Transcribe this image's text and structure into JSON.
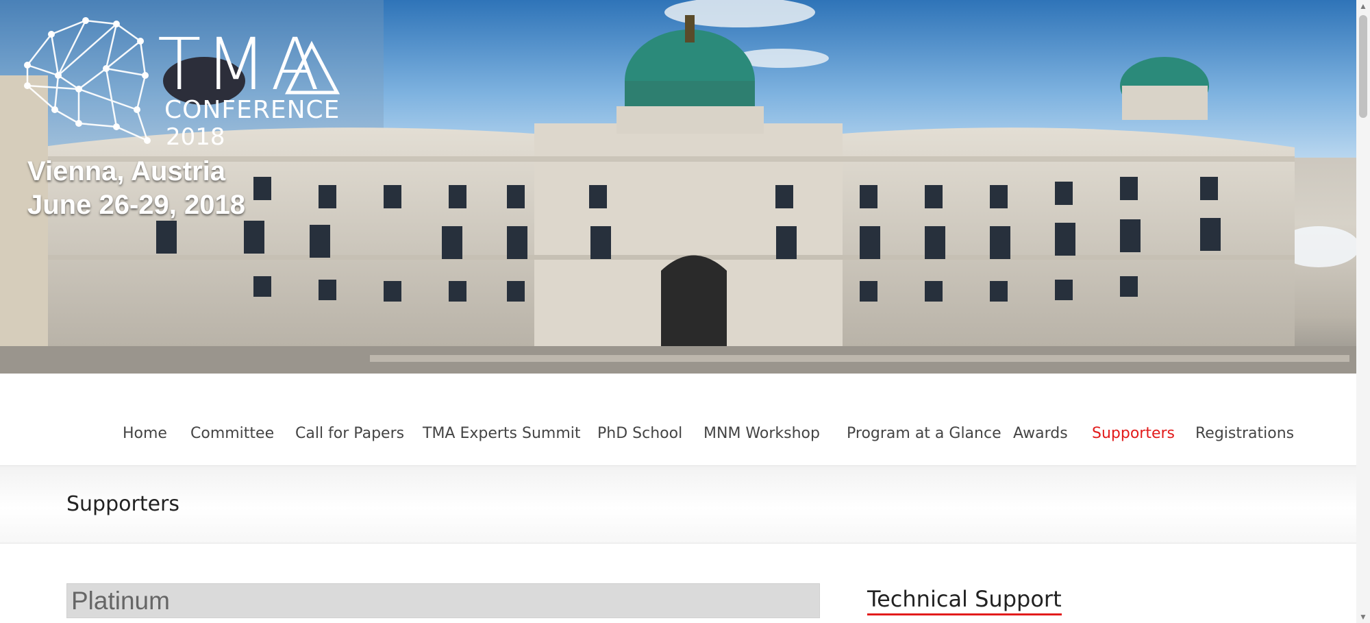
{
  "banner": {
    "logo": {
      "title": "TMA",
      "sub1": "CONFERENCE",
      "sub2": "2018"
    },
    "place": "Vienna, Austria",
    "date": "June 26-29, 2018"
  },
  "nav": {
    "items": [
      {
        "label": "Home"
      },
      {
        "label": "Committee"
      },
      {
        "label": "Call for Papers"
      },
      {
        "label": "TMA Experts Summit"
      },
      {
        "label": "PhD School"
      },
      {
        "label": "MNM Workshop"
      },
      {
        "label": "Program at a Glance"
      },
      {
        "label": "Awards"
      },
      {
        "label": "Supporters",
        "active": true
      },
      {
        "label": "Registrations"
      }
    ]
  },
  "page": {
    "title": "Supporters"
  },
  "content": {
    "section_header": "Platinum",
    "widget_title": "Technical Support"
  },
  "colors": {
    "accent": "#e21b1b",
    "text": "#444444"
  }
}
